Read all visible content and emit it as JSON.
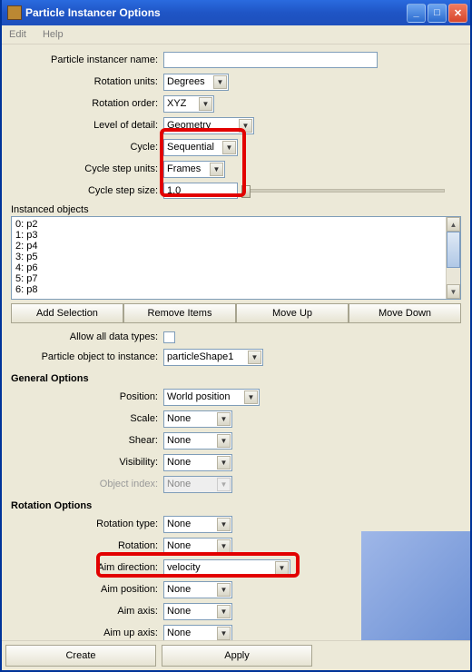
{
  "window": {
    "title": "Particle Instancer Options"
  },
  "menu": {
    "edit": "Edit",
    "help": "Help"
  },
  "fields": {
    "instancer_name_label": "Particle instancer name:",
    "instancer_name_value": "",
    "rotation_units_label": "Rotation units:",
    "rotation_units_value": "Degrees",
    "rotation_order_label": "Rotation order:",
    "rotation_order_value": "XYZ",
    "level_of_detail_label": "Level of detail:",
    "level_of_detail_value": "Geometry",
    "cycle_label": "Cycle:",
    "cycle_value": "Sequential",
    "cycle_step_units_label": "Cycle step units:",
    "cycle_step_units_value": "Frames",
    "cycle_step_size_label": "Cycle step size:",
    "cycle_step_size_value": "1.0"
  },
  "instanced": {
    "label": "Instanced objects",
    "items": [
      "0: p2",
      "1: p3",
      "2: p4",
      "3: p5",
      "4: p6",
      "5: p7",
      "6: p8"
    ]
  },
  "obj_buttons": {
    "add": "Add Selection",
    "remove": "Remove Items",
    "moveup": "Move Up",
    "movedown": "Move Down"
  },
  "data_types": {
    "allow_label": "Allow all data types:",
    "particle_object_label": "Particle object to instance:",
    "particle_object_value": "particleShape1"
  },
  "general": {
    "heading": "General Options",
    "position_label": "Position:",
    "position_value": "World position",
    "scale_label": "Scale:",
    "scale_value": "None",
    "shear_label": "Shear:",
    "shear_value": "None",
    "visibility_label": "Visibility:",
    "visibility_value": "None",
    "object_index_label": "Object index:",
    "object_index_value": "None"
  },
  "rotation": {
    "heading": "Rotation Options",
    "type_label": "Rotation type:",
    "type_value": "None",
    "rotation_label": "Rotation:",
    "rotation_value": "None",
    "aim_direction_label": "Aim direction:",
    "aim_direction_value": "velocity",
    "aim_position_label": "Aim position:",
    "aim_position_value": "None",
    "aim_axis_label": "Aim axis:",
    "aim_axis_value": "None",
    "aim_up_axis_label": "Aim up axis:",
    "aim_up_axis_value": "None"
  },
  "bottom": {
    "create": "Create",
    "apply": "Apply"
  }
}
